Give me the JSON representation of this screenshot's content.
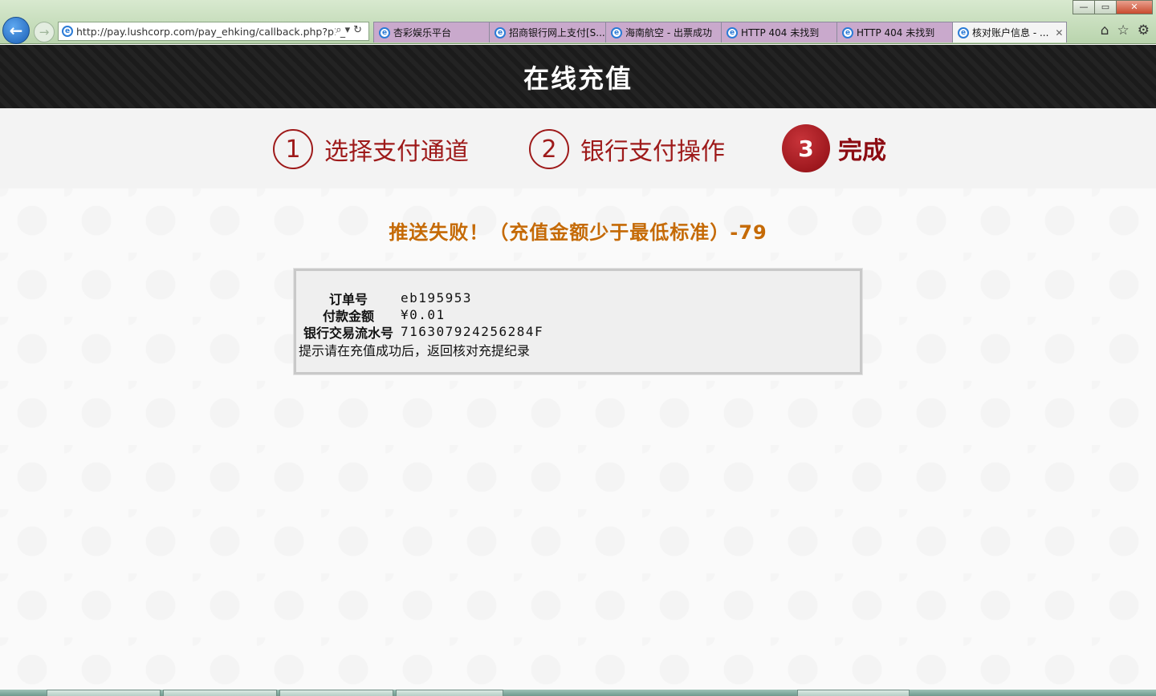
{
  "browser": {
    "address_url": "http://pay.lushcorp.com/pay_ehking/callback.php?p1_",
    "tabs": [
      {
        "label": "杏彩娱乐平台",
        "active": false
      },
      {
        "label": "招商银行网上支付[S...",
        "active": false
      },
      {
        "label": "海南航空 - 出票成功",
        "active": false
      },
      {
        "label": "HTTP 404 未找到",
        "active": false
      },
      {
        "label": "HTTP 404 未找到",
        "active": false
      },
      {
        "label": "核对账户信息 - ...",
        "active": true
      }
    ],
    "icons": [
      "back-arrow-icon",
      "forward-arrow-icon",
      "search-icon",
      "refresh-icon",
      "home-icon",
      "favorites-star-icon",
      "settings-gear-icon"
    ]
  },
  "header": {
    "title": "在线充值"
  },
  "steps": [
    {
      "number": "1",
      "label": "选择支付通道",
      "current": false
    },
    {
      "number": "2",
      "label": "银行支付操作",
      "current": false
    },
    {
      "number": "3",
      "label": "完成",
      "current": true
    }
  ],
  "result": {
    "message": "推送失败！（充值金额少于最低标准）-79",
    "color": "#c56a06"
  },
  "details": {
    "order_label": "订单号",
    "order_value": "eb195953",
    "amount_label": "付款金额",
    "amount_value": "¥0.01",
    "serial_label": "银行交易流水号",
    "serial_value": "716307924256284F",
    "note": "提示请在充值成功后，返回核对充提纪录"
  },
  "theme": {
    "accent": "#9e1a1a",
    "header_bg": "#1b1b1b"
  }
}
